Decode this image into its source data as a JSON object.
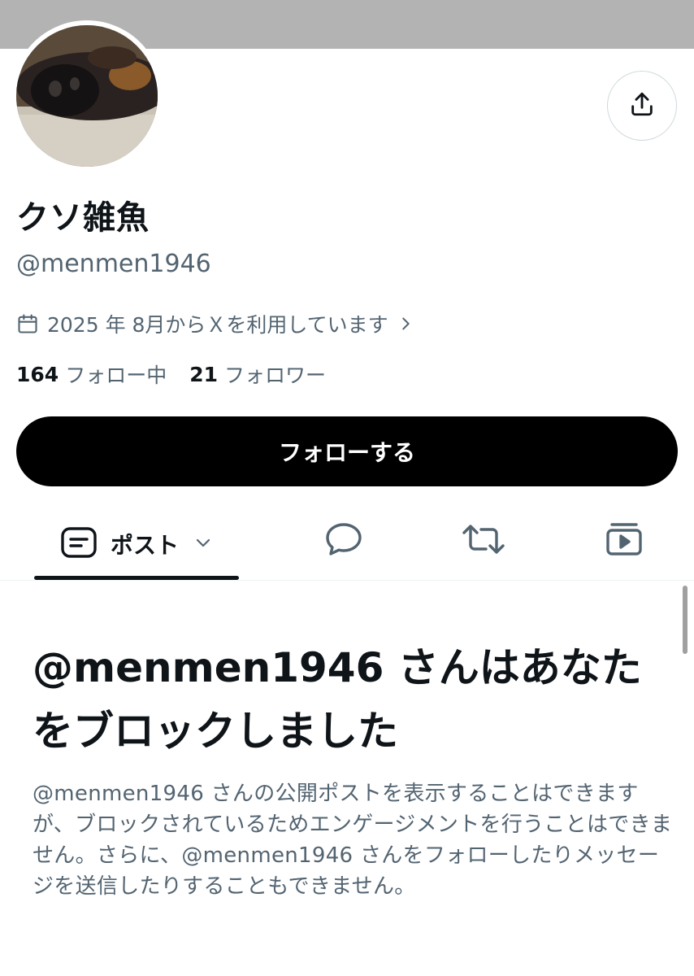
{
  "profile": {
    "display_name": "クソ雑魚",
    "handle": "@menmen1946",
    "joined": "2025 年 8月からＸを利用しています"
  },
  "stats": {
    "following_count": "164",
    "following_label": "フォロー中",
    "followers_count": "21",
    "followers_label": "フォロワー"
  },
  "actions": {
    "follow_label": "フォローする"
  },
  "tabs": {
    "posts_label": "ポスト"
  },
  "blocked": {
    "title": "@menmen1946 さんはあなたをブロックしました",
    "body": "@menmen1946 さんの公開ポストを表示することはできますが、ブロックされているためエンゲージメントを行うことはできません。さらに、@menmen1946 さんをフォローしたりメッセージを送信したりすることもできません。"
  },
  "icons": {
    "share": "share-icon",
    "calendar": "calendar-icon",
    "chevron_right": "chevron-right-icon",
    "posts": "posts-icon",
    "chevron_down": "chevron-down-icon",
    "replies": "reply-bubble-icon",
    "reposts": "repost-icon",
    "media": "media-icon"
  },
  "colors": {
    "banner": "#b3b3b3",
    "primary_text": "#0f1419",
    "secondary_text": "#536471",
    "follow_button_bg": "#000000",
    "follow_button_text": "#ffffff"
  }
}
